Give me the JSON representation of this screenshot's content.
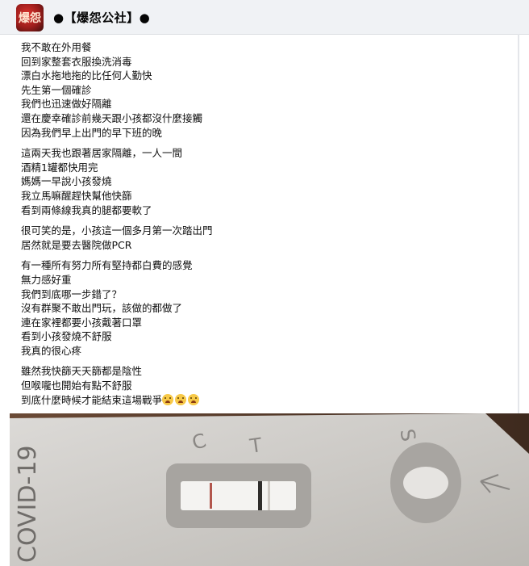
{
  "header": {
    "page_name": "●【爆怨公社】●",
    "avatar_text": "爆怨"
  },
  "post": {
    "paragraphs": [
      [
        "我不敢在外用餐",
        "回到家整套衣服換洗消毒",
        "漂白水拖地拖的比任何人勤快",
        "先生第一個確診",
        "我們也迅速做好隔離",
        "還在慶幸確診前幾天跟小孩都沒什麼接觸",
        "因為我們早上出門的早下班的晚"
      ],
      [
        "這兩天我也跟著居家隔離，一人一間",
        "酒精1罐都快用完",
        "媽媽一早說小孩發燒",
        "我立馬嘛醒趕快幫他快篩",
        "看到兩條線我真的腿都要軟了"
      ],
      [
        "很可笑的是，小孩這一個多月第一次踏出門",
        "居然就是要去醫院做PCR"
      ],
      [
        "有一種所有努力所有堅持都白費的感覺",
        "無力感好重",
        "我們到底哪一步錯了？",
        "沒有群聚不敢出門玩，該做的都做了",
        "連在家裡都要小孩戴著口罩",
        "看到小孩發燒不舒服",
        "我真的很心疼"
      ],
      [
        "雖然我快篩天天篩都是陰性",
        "但喉嚨也開始有點不舒服",
        "到底什麼時候才能結束這場戰爭"
      ]
    ],
    "trailing_emoji": [
      "crying-face-icon",
      "crying-face-icon",
      "crying-face-icon"
    ]
  },
  "photo": {
    "test_brand_text": "COVID-19",
    "marks": [
      "C",
      "T",
      "S"
    ],
    "result_lines": [
      "C",
      "T"
    ]
  }
}
